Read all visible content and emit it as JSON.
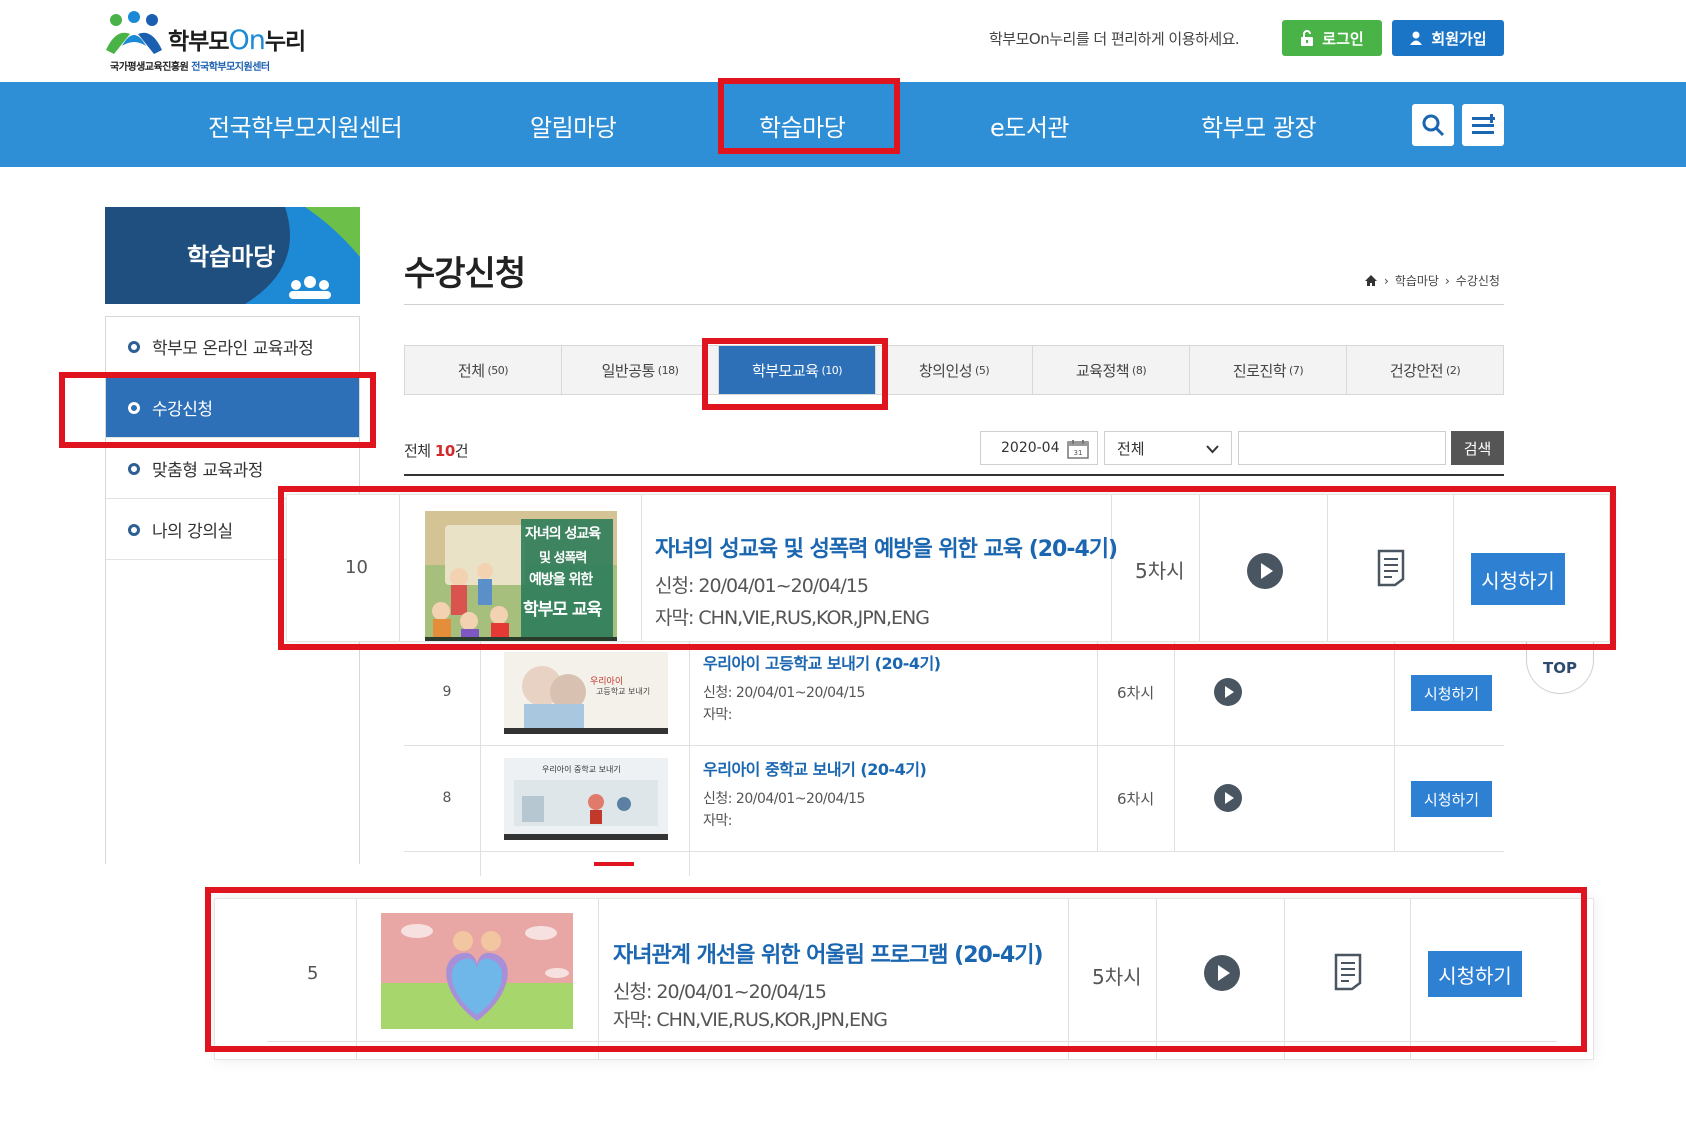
{
  "header": {
    "logo_text_main": "학부모",
    "logo_text_on": "On",
    "logo_text_tail": "누리",
    "logo_sub_1": "국가평생교육진흥원",
    "logo_sub_2": "전국학부모지원센터",
    "top_message": "학부모On누리를 더 편리하게 이용하세요.",
    "login_label": "로그인",
    "join_label": "회원가입",
    "colors": {
      "gnb": "#2e8ed6",
      "login": "#4ab348",
      "join": "#1a75c7"
    }
  },
  "gnb": {
    "items": [
      "전국학부모지원센터",
      "알림마당",
      "학습마당",
      "e도서관",
      "학부모 광장"
    ],
    "search_icon": "search-icon",
    "menu_icon": "menu-icon"
  },
  "sidebar": {
    "title": "학습마당",
    "items": [
      {
        "label": "학부모 온라인 교육과정"
      },
      {
        "label": "수강신청",
        "active": true
      },
      {
        "label": "맞춤형 교육과정"
      },
      {
        "label": "나의 강의실"
      }
    ]
  },
  "content": {
    "page_title": "수강신청",
    "breadcrumb": [
      "학습마당",
      "수강신청"
    ],
    "tabs": [
      {
        "label": "전체",
        "count": "(50)"
      },
      {
        "label": "일반공통",
        "count": "(18)"
      },
      {
        "label": "학부모교육",
        "count": "(10)",
        "active": true
      },
      {
        "label": "창의인성",
        "count": "(5)"
      },
      {
        "label": "교육정책",
        "count": "(8)"
      },
      {
        "label": "진로진학",
        "count": "(7)"
      },
      {
        "label": "건강안전",
        "count": "(2)"
      }
    ],
    "total_prefix": "전체",
    "total_count": "10",
    "total_suffix": "건",
    "date_value": "2020-04",
    "select_value": "전체",
    "search_label": "검색",
    "rows": [
      {
        "no": "9",
        "title": "우리아이 고등학교 보내기 (20-4기)",
        "apply": "신청: 20/04/01~20/04/15",
        "subtitle": "자막:",
        "sessions": "6차시",
        "watch": "시청하기"
      },
      {
        "no": "8",
        "title": "우리아이 중학교 보내기 (20-4기)",
        "apply": "신청: 20/04/01~20/04/15",
        "subtitle": "자막:",
        "sessions": "6차시",
        "watch": "시청하기"
      }
    ],
    "zoom_rows": [
      {
        "no": "10",
        "title": "자녀의 성교육 및 성폭력 예방을 위한 교육 (20-4기)",
        "apply": "신청: 20/04/01~20/04/15",
        "subtitle": "자막: CHN,VIE,RUS,KOR,JPN,ENG",
        "sessions": "5차시",
        "watch": "시청하기",
        "thumb_text": [
          "자녀의 성교육",
          "및 성폭력",
          "예방을 위한",
          "학부모 교육"
        ]
      },
      {
        "no": "5",
        "title": "자녀관계 개선을 위한 어울림 프로그램 (20-4기)",
        "apply": "신청: 20/04/01~20/04/15",
        "subtitle": "자막: CHN,VIE,RUS,KOR,JPN,ENG",
        "sessions": "5차시",
        "watch": "시청하기"
      }
    ],
    "thumb_text_9": [
      "우리아이",
      "고등학교 보내기"
    ],
    "thumb_text_8": "우리아이 중학교 보내기",
    "top_label": "TOP"
  }
}
